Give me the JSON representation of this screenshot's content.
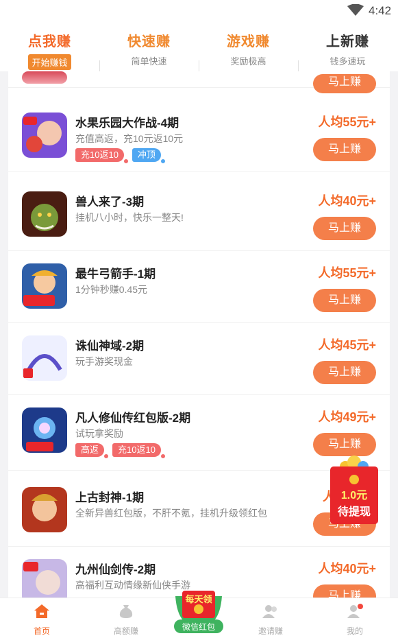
{
  "status": {
    "time": "4:42",
    "wifi_icon": "wifi-icon"
  },
  "top_tabs": [
    {
      "title": "点我赚",
      "sub": "开始赚钱"
    },
    {
      "title": "快速赚",
      "sub": "简单快速"
    },
    {
      "title": "游戏赚",
      "sub": "奖励极高"
    },
    {
      "title": "上新赚",
      "sub": "钱多速玩"
    }
  ],
  "colors": {
    "accent": "#f36a2a",
    "button": "#f47f4a",
    "tag_red": "#f26a6a",
    "tag_blue": "#4fa7f2"
  },
  "list": {
    "partial_button": "马上赚",
    "items": [
      {
        "title": "水果乐园大作战-4期",
        "desc": "充值高返，充10元返10元",
        "price": "人均55元+",
        "button": "马上赚",
        "tags": [
          {
            "label": "充10返10",
            "color": "red"
          },
          {
            "label": "冲顶",
            "color": "blue"
          }
        ],
        "icon": "fruit-game-icon"
      },
      {
        "title": "兽人来了-3期",
        "desc": "挂机八小时，快乐一整天!",
        "price": "人均40元+",
        "button": "马上赚",
        "tags": [],
        "icon": "orc-game-icon"
      },
      {
        "title": "最牛弓箭手-1期",
        "desc": "1分钟秒赚0.45元",
        "price": "人均55元+",
        "button": "马上赚",
        "tags": [],
        "icon": "archer-game-icon"
      },
      {
        "title": "诛仙神域-2期",
        "desc": "玩手游奖现金",
        "price": "人均45元+",
        "button": "马上赚",
        "tags": [],
        "icon": "shenyu-game-icon"
      },
      {
        "title": "凡人修仙传红包版-2期",
        "desc": "试玩拿奖励",
        "price": "人均49元+",
        "button": "马上赚",
        "tags": [
          {
            "label": "高返",
            "color": "red"
          },
          {
            "label": "充10返10",
            "color": "red"
          }
        ],
        "icon": "xiuxian-game-icon"
      },
      {
        "title": "上古封神-1期",
        "desc": "全新异兽红包版，不肝不氪，挂机升级领红包",
        "price": "人均",
        "button": "马上赚",
        "tags": [],
        "icon": "fengshen-game-icon"
      },
      {
        "title": "九州仙剑传-2期",
        "desc": "高福利互动情缘新仙侠手游",
        "price": "人均40元+",
        "button": "马上赚",
        "tags": [],
        "icon": "xianjian-game-icon"
      }
    ]
  },
  "red_packet": {
    "amount": "1.0元",
    "text": "待提现"
  },
  "bottom_nav": [
    {
      "label": "首页",
      "icon": "home-icon"
    },
    {
      "label": "高额赚",
      "icon": "money-bag-icon"
    },
    {
      "label": "微信红包",
      "badge": "每天领",
      "icon": "wechat-redpacket-icon"
    },
    {
      "label": "邀请赚",
      "icon": "invite-icon"
    },
    {
      "label": "我的",
      "icon": "profile-icon"
    }
  ]
}
